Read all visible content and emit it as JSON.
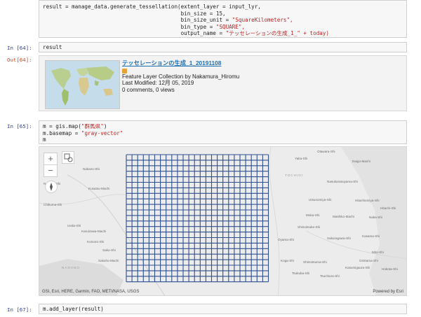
{
  "cells": {
    "cell63": {
      "code_lines": [
        [
          "result = manage_data.generate_tessellation(extent_layer = input_lyr,",
          ""
        ],
        [
          "                                           bin_size = 15,",
          ""
        ],
        [
          "                                           bin_size_unit = ",
          "\"SquareKilometers\","
        ],
        [
          "                                           bin_type = ",
          "\"SQUARE\","
        ],
        [
          "                                           output_name = ",
          "\"テッセレーションの生成_1_\" + today)"
        ]
      ]
    },
    "cell64": {
      "prompt": "In [64]:",
      "code": "result",
      "out_prompt": "Out[64]:",
      "item": {
        "title": "テッセレーションの生成_1_20191108",
        "type": "Feature Layer Collection by Nakamura_Hiromu",
        "modified": "Last Modified: 12月 05, 2019",
        "stats": "0 comments, 0 views"
      }
    },
    "cell65": {
      "prompt": "In [65]:",
      "line1_a": "m = gis.map(",
      "line1_str": "\"群馬県\"",
      "line1_b": ")",
      "line2_a": "m.basemap = ",
      "line2_str": "\"gray-vector\"",
      "line3": "m"
    },
    "map": {
      "zoom_in": "+",
      "zoom_out": "−",
      "attribution": "GSI, Esri, HERE, Garmin, FAO, METI/NASA, USGS",
      "powered_by": "Powered by Esri",
      "places": [
        "Otawara-Shi",
        "Yaita-Shi",
        "Daigo-Machi",
        "Nakano-Shi",
        "Nagano-Shi",
        "Kusatsu-Machi",
        "Chikuma-Shi",
        "Ueda-Shi",
        "Karuizawa-Machi",
        "Komoro-Shi",
        "Saku-Shi",
        "Sakuho-Machi",
        "Nasukarasuyama-Shi",
        "Utsunomiya-Shi",
        "Hitachiomiya-Shi",
        "Hitachi-Shi",
        "Moka-Shi",
        "Mashiko-Machi",
        "Naka-Shi",
        "Shimotsuke-Shi",
        "Oyama-Shi",
        "Sakuragawa-Shi",
        "Kasama-Shi",
        "Mito-Shi",
        "Koga-Shi",
        "Shimotsuma-Shi",
        "Tsukuba-Shi",
        "Omitama-Shi",
        "Kasumigaura-Shi",
        "Hokota-Shi",
        "Tsuchiura-Shi",
        "TOCHIGI",
        "NAGANO"
      ]
    },
    "cell67": {
      "prompt": "In [67]:",
      "code": "m.add_layer(result)"
    }
  },
  "colors": {
    "grid": "#2f4f8f",
    "in_prompt": "#303f9f",
    "out_prompt": "#d84315",
    "string": "#ba2121"
  }
}
